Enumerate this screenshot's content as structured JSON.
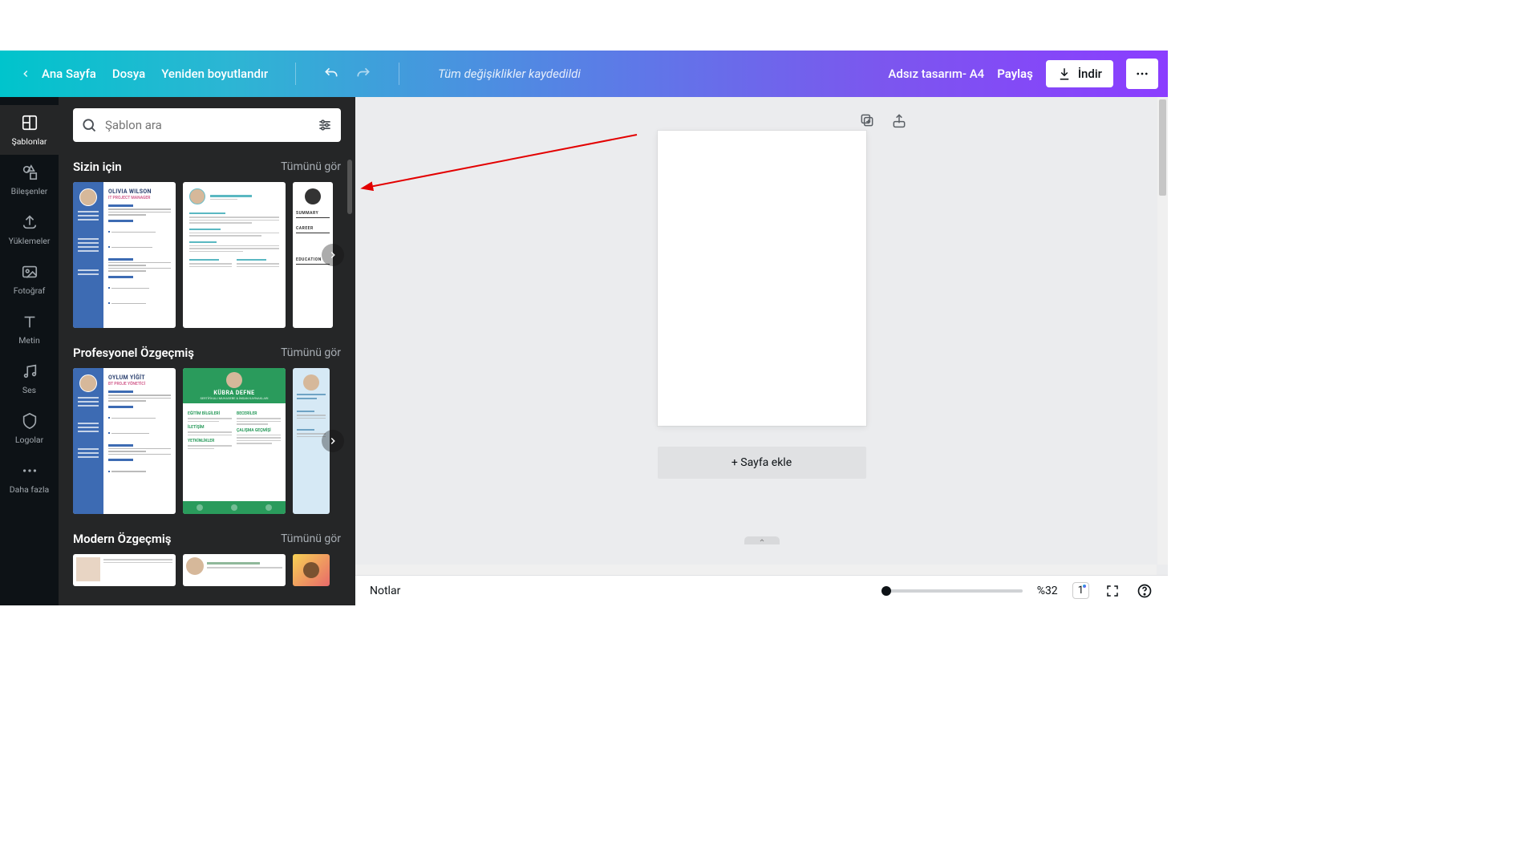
{
  "topbar": {
    "home": "Ana Sayfa",
    "file": "Dosya",
    "resize": "Yeniden boyutlandır",
    "status": "Tüm değişiklikler kaydedildi",
    "design_name": "Adsız tasarım- A4",
    "share": "Paylaş",
    "download": "İndir"
  },
  "rail": {
    "items": [
      {
        "label": "Şablonlar"
      },
      {
        "label": "Bileşenler"
      },
      {
        "label": "Yüklemeler"
      },
      {
        "label": "Fotoğraf"
      },
      {
        "label": "Metin"
      },
      {
        "label": "Ses"
      },
      {
        "label": "Logolar"
      },
      {
        "label": "Daha fazla"
      }
    ]
  },
  "panel": {
    "search_placeholder": "Şablon ara",
    "sections": [
      {
        "title": "Sizin için",
        "see_all": "Tümünü gör",
        "templates": [
          {
            "name": "OLIVIA WILSON"
          },
          {
            "name": ""
          },
          {
            "name": ""
          }
        ]
      },
      {
        "title": "Profesyonel Özgeçmiş",
        "see_all": "Tümünü gör",
        "templates": [
          {
            "name": "OYLUM YİĞİT"
          },
          {
            "name": "KÜBRA DEFNE"
          },
          {
            "name": ""
          }
        ]
      },
      {
        "title": "Modern Özgeçmiş",
        "see_all": "Tümünü gör",
        "templates": []
      }
    ]
  },
  "canvas": {
    "add_page": "+ Sayfa ekle"
  },
  "statusbar": {
    "notes": "Notlar",
    "zoom": "%32",
    "page_count": "1"
  }
}
